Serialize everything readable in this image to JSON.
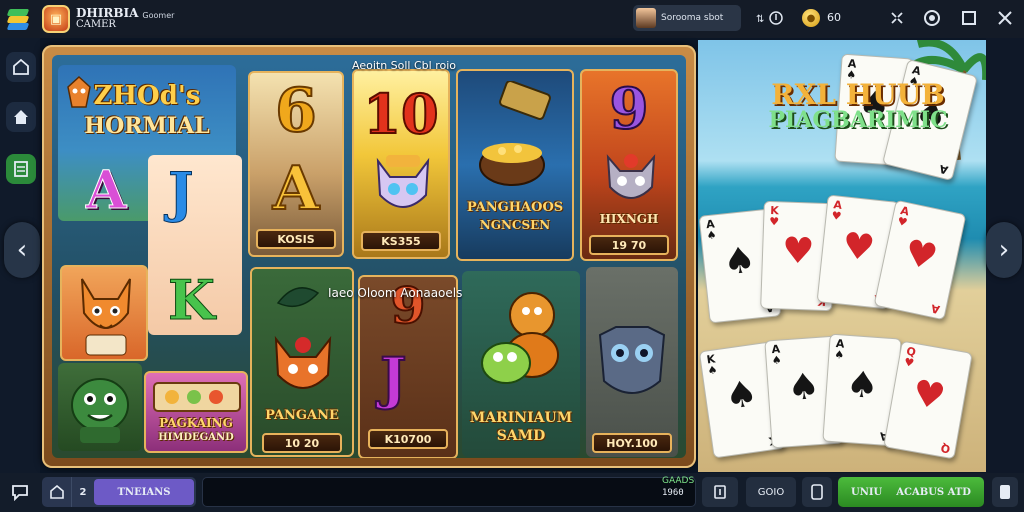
{
  "titlebar": {
    "app_title_line1": "DHIRBIA",
    "app_title_line2": "CAMER",
    "app_tag": "Goomer",
    "account_label": "Sorooma sbot",
    "coin_count": "60",
    "icons": [
      "bluestacks-logo",
      "app-icon",
      "avatar",
      "multi-instance-icon",
      "coin-icon",
      "collapse-icon",
      "record-icon",
      "maximize-icon",
      "close-icon"
    ]
  },
  "leftbar": {
    "icons": [
      "home-icon",
      "house-icon",
      "library-icon"
    ]
  },
  "game": {
    "top_caption": "Aeoitn  Soll  Cbl  roio",
    "mid_caption": "Iaeo  Oloom  Aonaaoels",
    "title_line1": "ZHOd's",
    "title_line2": "HORMIAL",
    "cells": {
      "c6": {
        "glyph": "6",
        "letter": "A",
        "value": "KOSIS"
      },
      "c10": {
        "glyph": "10",
        "value": "KS355"
      },
      "pot": {
        "caption_line1": "PANGHAOOS",
        "caption_line2": "NGNCSEN"
      },
      "c9": {
        "glyph": "9",
        "caption": "HIXNGH",
        "value": "19 70"
      },
      "pack": {
        "caption_line1": "PAGKAING",
        "caption_line2": "HIMDEGAND"
      },
      "panda": {
        "caption": "PANGANE",
        "value": "10 20"
      },
      "c9j": {
        "glyph_top": "9",
        "glyph": "J",
        "value": "K10700"
      },
      "monkey": {
        "caption_line1": "MARINIAUM",
        "caption_line2": "SAMD"
      },
      "owl": {
        "value": "HOY.100"
      }
    },
    "letters": {
      "A": "A",
      "J": "J",
      "K": "K"
    }
  },
  "scene": {
    "title_line1": "RXL  HUUB",
    "title_line2": "PIAGBARIMIC",
    "cards": [
      {
        "rank": "A",
        "suit": "♠"
      },
      {
        "rank": "A",
        "suit": "♠"
      },
      {
        "rank": "A",
        "suit": "♠"
      },
      {
        "rank": "K",
        "suit": "♥"
      },
      {
        "rank": "A",
        "suit": "♥"
      },
      {
        "rank": "A",
        "suit": "♥"
      },
      {
        "rank": "K",
        "suit": "♠"
      },
      {
        "rank": "A",
        "suit": "♠"
      },
      {
        "rank": "A",
        "suit": "♠"
      },
      {
        "rank": "Q",
        "suit": "♥"
      }
    ]
  },
  "bottombar": {
    "mode_number": "2",
    "mode_label": "TNEIANS",
    "balance_label": "GAADS",
    "balance_value": "1960",
    "chip_label": "GOIO",
    "action_label_1": "UNIU",
    "action_label_2": "ACABUS ATD"
  },
  "colors": {
    "frame": "#c98c46",
    "accent_green": "#4cbb3c",
    "mode_purple": "#6d5ac6"
  }
}
